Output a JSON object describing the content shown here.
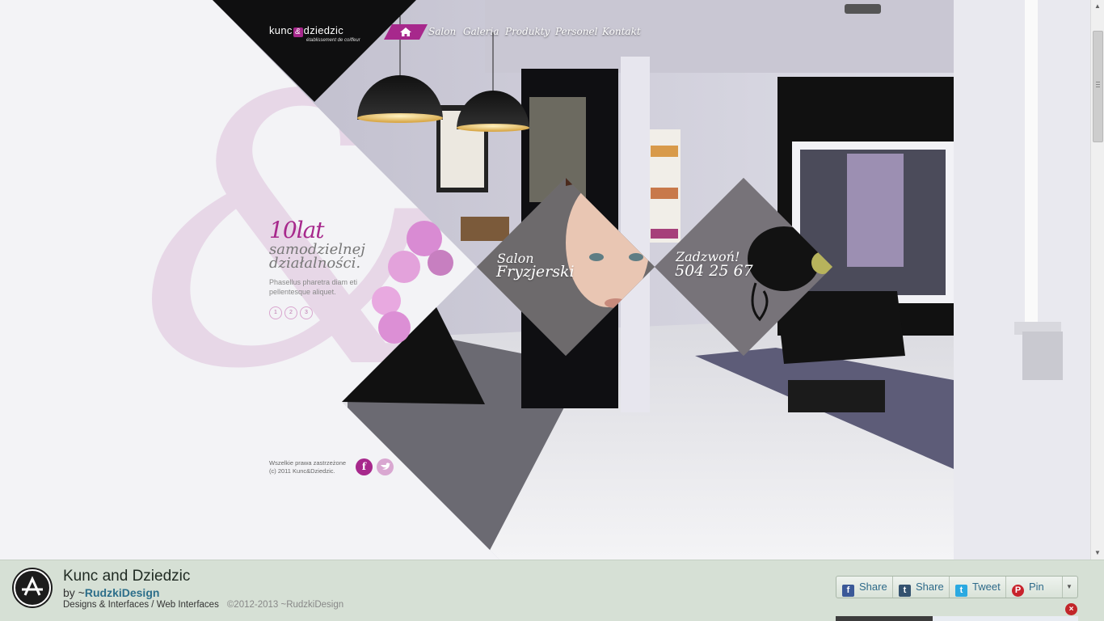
{
  "logo": {
    "name_before": "kunc",
    "name_amp": "&",
    "name_after": "dziedzic",
    "tagline": "établissement de coiffeur"
  },
  "nav": {
    "home_icon": "home-icon",
    "items": [
      {
        "label": "Salon"
      },
      {
        "label": "Galeria"
      },
      {
        "label": "Produkty"
      },
      {
        "label": "Personel"
      },
      {
        "label": "Kontakt"
      }
    ]
  },
  "hero": {
    "big": "10lat",
    "line1": "samodzielnej",
    "line2": "działalności.",
    "body": "Phasellus pharetra diam eti pellentesque aliquet.",
    "pages": [
      "1",
      "2",
      "3"
    ]
  },
  "tiles": {
    "salon_line1": "Salon",
    "salon_line2": "Fryzjerski",
    "call_line1": "Zadzwoń!",
    "call_line2": "504 25 67"
  },
  "page_footer": {
    "rights": "Wszelkie prawa zastrzeżone",
    "copyright": "(c) 2011 Kunc&Dziedzic.",
    "facebook_icon": "facebook-icon",
    "twitter_icon": "twitter-icon"
  },
  "deviation": {
    "title": "Kunc and Dziedzic",
    "by_prefix": "by ~",
    "author": "RudzkiDesign",
    "category": "Designs & Interfaces / Web Interfaces",
    "copyright": "©2012-2013 ~RudzkiDesign"
  },
  "share": {
    "facebook": "Share",
    "tumblr": "Share",
    "twitter": "Tweet",
    "pinterest": "Pin"
  },
  "colors": {
    "accent": "#a7288c",
    "bar_bg": "#d6e0d5",
    "link": "#2c6e8a"
  }
}
